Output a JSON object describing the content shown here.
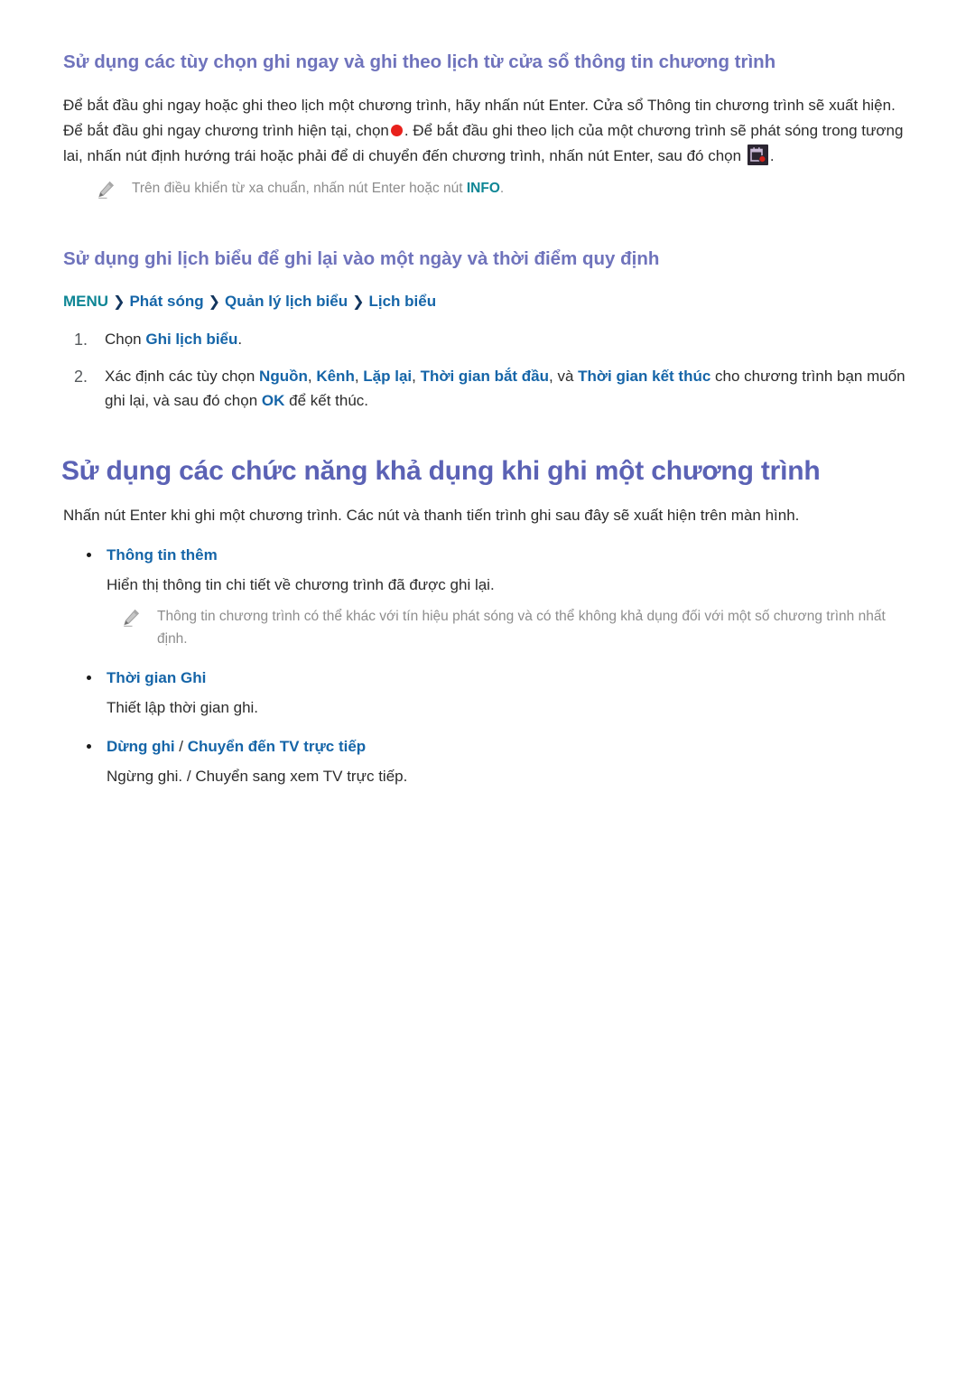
{
  "section_1": {
    "heading": "Sử dụng các tùy chọn ghi ngay và ghi theo lịch từ cửa sổ thông tin chương trình",
    "paragraph_part_1": "Để bắt đầu ghi ngay hoặc ghi theo lịch một chương trình, hãy nhấn nút Enter. Cửa sổ Thông tin chương trình sẽ xuất hiện. Để bắt đầu ghi ngay chương trình hiện tại, chọn",
    "paragraph_part_2": ". Để bắt đầu ghi theo lịch của một chương trình sẽ phát sóng trong tương lai, nhấn nút định hướng trái hoặc phải để di chuyển đến chương trình, nhấn nút Enter, sau đó chọn",
    "paragraph_part_3": ".",
    "record_icon_name": "record-dot-icon",
    "schedule_icon_name": "schedule-recording-icon",
    "note_part_1": "Trên điều khiển từ xa chuẩn, nhấn nút Enter hoặc nút ",
    "note_keyword": "INFO",
    "note_part_2": "."
  },
  "section_2": {
    "heading": "Sử dụng ghi lịch biểu để ghi lại vào một ngày và thời điểm quy định",
    "breadcrumb": {
      "menu_label": "MENU",
      "separator": "❯",
      "items": [
        {
          "label": "Phát sóng"
        },
        {
          "label": "Quản lý lịch biểu"
        },
        {
          "label": "Lịch biểu"
        }
      ]
    },
    "steps": [
      {
        "number": "1.",
        "part_1": "Chọn ",
        "keyword_1": "Ghi lịch biểu",
        "part_2": ".",
        "keyword_2": "",
        "part_3": "",
        "keyword_3": "",
        "part_4": "",
        "keyword_4": "",
        "part_5": "",
        "keyword_5": "",
        "part_6": "",
        "keyword_6": "",
        "part_7": ""
      },
      {
        "number": "2.",
        "part_1": "Xác định các tùy chọn ",
        "keyword_1": "Nguồn",
        "part_2": ", ",
        "keyword_2": "Kênh",
        "part_3": ", ",
        "keyword_3": "Lặp lại",
        "part_4": ", ",
        "keyword_4": "Thời gian bắt đầu",
        "part_5": ", và ",
        "keyword_5": "Thời gian kết thúc",
        "part_6": " cho chương trình bạn muốn ghi lại, và sau đó chọn ",
        "keyword_6": "OK",
        "part_7": " để kết thúc."
      }
    ]
  },
  "section_3": {
    "heading": "Sử dụng các chức năng khả dụng khi ghi một chương trình",
    "intro": "Nhấn nút Enter khi ghi một chương trình. Các nút và thanh tiến trình ghi sau đây sẽ xuất hiện trên màn hình.",
    "items": [
      {
        "title": "Thông tin thêm",
        "title_suffix": "",
        "title_secondary": "",
        "description": "Hiển thị thông tin chi tiết về chương trình đã được ghi lại.",
        "note": "Thông tin chương trình có thể khác với tín hiệu phát sóng và có thể không khả dụng đối với một số chương trình nhất định."
      },
      {
        "title": "Thời gian Ghi",
        "title_suffix": "",
        "title_secondary": "",
        "description": "Thiết lập thời gian ghi.",
        "note": ""
      },
      {
        "title": "Dừng ghi",
        "title_suffix": " / ",
        "title_secondary": "Chuyển đến TV trực tiếp",
        "description": "Ngừng ghi. / Chuyển sang xem TV trực tiếp.",
        "note": ""
      }
    ]
  },
  "colors": {
    "heading_h1": "#5b62b5",
    "heading_h2": "#6f73bc",
    "keyword_blue": "#1565a8",
    "keyword_teal": "#0e8695",
    "body_text": "#2c2c2c",
    "note_text": "#8d8d8d",
    "record_red": "#e8211c"
  }
}
